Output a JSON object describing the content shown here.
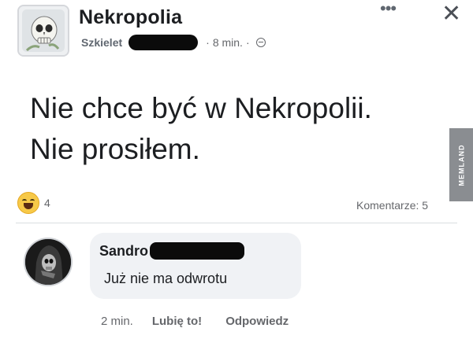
{
  "post": {
    "group_name": "Nekropolia",
    "author": "Szkielet",
    "time": "8 min.",
    "meta_separator": "·",
    "more_icon": "more-horizontal-icon",
    "close_icon": "close-icon",
    "text_line1": "Nie chce być w Nekropolii.",
    "text_line2": "Nie prosiłem.",
    "reaction_icon": "haha-reaction-icon",
    "reaction_count": "4",
    "comments_label": "Komentarze: 5"
  },
  "watermark": {
    "text": "MEMLAND"
  },
  "comment": {
    "author": "Sandro",
    "text": "Już nie ma odwrotu",
    "time": "2 min.",
    "like_label": "Lubię to!",
    "reply_label": "Odpowiedz"
  },
  "colors": {
    "text": "#1c1e21",
    "secondary": "#65676b",
    "bubble": "#f0f2f5",
    "redaction": "#0b0b0b"
  }
}
